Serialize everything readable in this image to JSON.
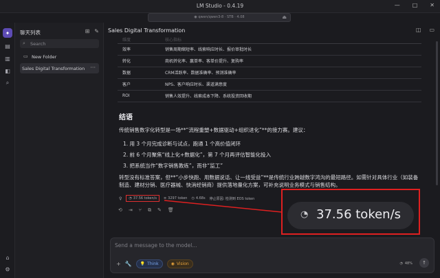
{
  "window": {
    "title": "LM Studio - 0.4.19",
    "model_pill": "◉ qwen/qwen3-8 · STB · 4.08",
    "minimize": "—",
    "maximize": "□",
    "close": "✕"
  },
  "sidebar": {
    "header": "聊天列表",
    "search_placeholder": "Search",
    "folder_label": "New Folder",
    "active_chat": "Sales Digital Transformation",
    "more": "···"
  },
  "main": {
    "title": "Sales Digital Transformation"
  },
  "table": {
    "header_row": [
      "维度",
      "核心指标"
    ],
    "rows": [
      [
        "效率",
        "销售周期缩短率、线索响应时长、报价审批时长"
      ],
      [
        "转化",
        "商机转化率、赢单率、客单价提升、复购率"
      ],
      [
        "数据",
        "CRM活跃率、数据准确率、预测准确率"
      ],
      [
        "客户",
        "NPS、客户响应时长、渠道满意度"
      ],
      [
        "ROI",
        "销售人效提升、线索成本下降、系统投资回收期"
      ]
    ]
  },
  "content": {
    "heading": "结语",
    "intro": "传统销售数字化转型是一场**“流程重塑+数据驱动+组织进化”**的接力赛。建议：",
    "list": [
      "1. 用 3 个月完成诊断与试点，跑通 1 个高价值闭环",
      "2. 前 6 个月聚焦“线上化+数据化”，第 7 个月再评估智能化投入",
      "3. 把系统当作“数字销售教练”，而非“监工”"
    ],
    "closing": "转型没有标准答案，但**“小步快跑、用数据说话、让一线受益”**是传统行业跨越数字鸿沟的最短路径。如需针对具体行业（如装备制造、建材分销、医疗器械、快消经销商）提供落地量化方案，可补充说明业务模式与销售结构。"
  },
  "stats": {
    "speed": "37.56 token/s",
    "tokens": "3297 token",
    "time": "4.68s",
    "stop_reason": "停止原因: 检测到 EOS token"
  },
  "callout": {
    "value": "37.56 token/s"
  },
  "composer": {
    "placeholder": "Send a message to the model...",
    "think_label": "Think",
    "vision_label": "Vision",
    "context_pct": "48%"
  },
  "colors": {
    "accent_purple": "#5d4bb4",
    "highlight_red": "#e02020",
    "think_blue": "#7aa8f0",
    "vision_orange": "#e7a23b"
  }
}
